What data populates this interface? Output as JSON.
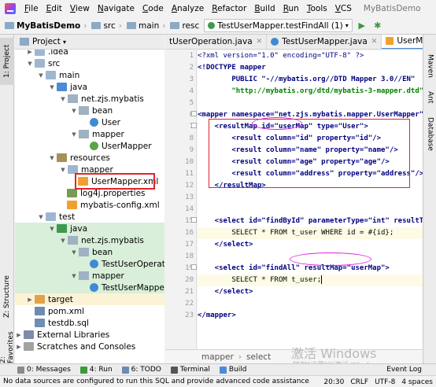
{
  "menu": [
    "File",
    "Edit",
    "View",
    "Navigate",
    "Code",
    "Analyze",
    "Refactor",
    "Build",
    "Run",
    "Tools",
    "VCS"
  ],
  "project_name": "MyBatisDemo",
  "breadcrumbs": [
    "MyBatisDemo",
    "src",
    "main",
    "resc"
  ],
  "run_config": "TestUserMapper.testFindAll (1)",
  "project_panel": {
    "title": "Project"
  },
  "left_tabs": {
    "project": "1: Project",
    "structure": "Z: Structure",
    "favorites": "2: Favorites"
  },
  "right_tabs": {
    "maven": "Maven",
    "ant": "Ant",
    "database": "Database"
  },
  "tree": [
    {
      "label": ".idea",
      "icon": "folder-icon"
    },
    {
      "label": "src",
      "icon": "folder-icon"
    },
    {
      "label": "main",
      "icon": "folder-icon"
    },
    {
      "label": "java",
      "icon": "source-folder-icon"
    },
    {
      "label": "net.zjs.mybatis",
      "icon": "package-icon"
    },
    {
      "label": "bean",
      "icon": "package-icon"
    },
    {
      "label": "User",
      "icon": "class-icon"
    },
    {
      "label": "mapper",
      "icon": "package-icon"
    },
    {
      "label": "UserMapper",
      "icon": "interface-icon"
    },
    {
      "label": "resources",
      "icon": "resources-folder-icon"
    },
    {
      "label": "mapper",
      "icon": "folder-icon"
    },
    {
      "label": "UserMapper.xml",
      "icon": "xml-file-icon"
    },
    {
      "label": "log4j.properties",
      "icon": "properties-file-icon"
    },
    {
      "label": "mybatis-config.xml",
      "icon": "xml-file-icon"
    },
    {
      "label": "test",
      "icon": "folder-icon"
    },
    {
      "label": "java",
      "icon": "test-folder-icon"
    },
    {
      "label": "net.zjs.mybatis",
      "icon": "package-icon"
    },
    {
      "label": "bean",
      "icon": "package-icon"
    },
    {
      "label": "TestUserOperation",
      "icon": "class-icon"
    },
    {
      "label": "mapper",
      "icon": "package-icon"
    },
    {
      "label": "TestUserMapper",
      "icon": "class-icon"
    },
    {
      "label": "target",
      "icon": "excluded-folder-icon"
    },
    {
      "label": "pom.xml",
      "icon": "maven-file-icon"
    },
    {
      "label": "testdb.sql",
      "icon": "sql-file-icon"
    },
    {
      "label": "External Libraries",
      "icon": "library-icon"
    },
    {
      "label": "Scratches and Consoles",
      "icon": "scratches-icon"
    }
  ],
  "editor_tabs": [
    "tUserOperation.java",
    "TestUserMapper.java",
    "UserMapper.xml"
  ],
  "code_lines": {
    "l1": "<?xml version=\"1.0\" encoding=\"UTF-8\" ?>",
    "l2": "<!DOCTYPE mapper",
    "l3": "        PUBLIC \"-//mybatis.org//DTD Mapper 3.0//EN\"",
    "l4": "        \"http://mybatis.org/dtd/mybatis-3-mapper.dtd\">",
    "l6": "<mapper namespace=\"net.zjs.mybatis.mapper.UserMapper\">",
    "l7": "    <resultMap id=\"userMap\" type=\"User\">",
    "l8": "        <result column=\"id\" property=\"id\"/>",
    "l9": "        <result column=\"name\" property=\"name\"/>",
    "l10": "        <result column=\"age\" property=\"age\"/>",
    "l11": "        <result column=\"address\" property=\"address\"/>",
    "l12": "    </resultMap>",
    "l15": "    <select id=\"findById\" parameterType=\"int\" resultType=\"",
    "l16": "        SELECT * FROM t_user WHERE id = #{id};",
    "l17": "    </select>",
    "l19": "    <select id=\"findAll\" resultMap=\"userMap\">",
    "l20": "        SELECT * FROM t_user;",
    "l21": "    </select>",
    "l23": "</mapper>"
  },
  "editor_breadcrumb": [
    "mapper",
    "select"
  ],
  "watermark": {
    "line1": "激活 Windows",
    "line2": "转到\"设置\"以激活 Windows。"
  },
  "tool_windows": [
    "0: Messages",
    "4: Run",
    "6: TODO",
    "Terminal",
    "Build",
    "Event Log"
  ],
  "status": {
    "message": "No data sources are configured to run this SQL and provide advanced code assistance",
    "position": "20:30",
    "line_sep": "CRLF",
    "encoding": "UTF-8",
    "indent": "4 spaces"
  },
  "colors": {
    "selection_box": "#e0242a",
    "highlight_ellipse": "#e020e0",
    "tag": "#000080",
    "attr": "#0000ff",
    "value": "#008000"
  }
}
